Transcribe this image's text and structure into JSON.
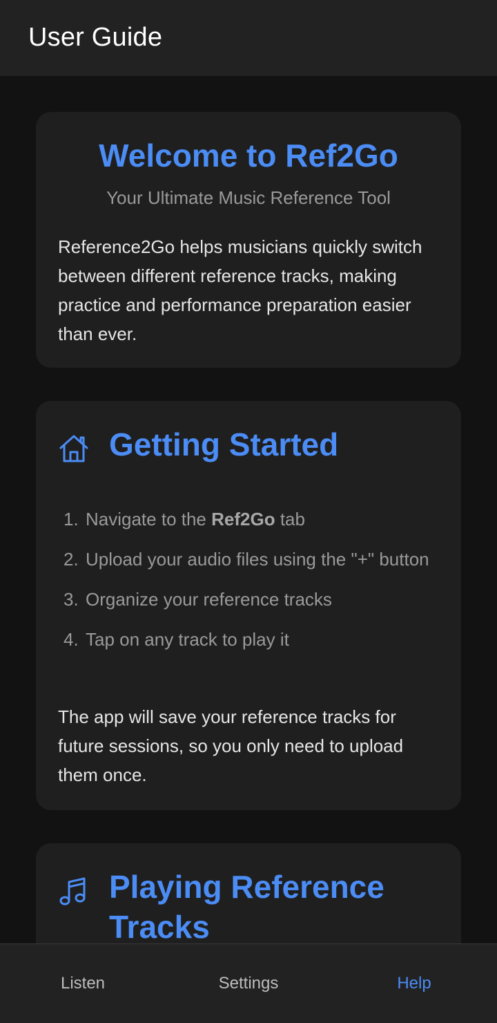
{
  "header": {
    "title": "User Guide"
  },
  "welcome": {
    "title": "Welcome to Ref2Go",
    "subtitle": "Your Ultimate Music Reference Tool",
    "body": "Reference2Go helps musicians quickly switch between different reference tracks, making practice and performance preparation easier than ever."
  },
  "getting_started": {
    "icon": "home-icon",
    "title": "Getting Started",
    "steps": [
      {
        "num": "1.",
        "before": "Navigate to the ",
        "bold": "Ref2Go",
        "after": " tab"
      },
      {
        "num": "2.",
        "text": "Upload your audio files using the \"+\" button"
      },
      {
        "num": "3.",
        "text": "Organize your reference tracks"
      },
      {
        "num": "4.",
        "text": "Tap on any track to play it"
      }
    ],
    "footer": "The app will save your reference tracks for future sessions, so you only need to upload them once."
  },
  "playing": {
    "icon": "music-note-icon",
    "title": "Playing Reference Tracks"
  },
  "tabs": [
    {
      "label": "Listen",
      "active": false
    },
    {
      "label": "Settings",
      "active": false
    },
    {
      "label": "Help",
      "active": true
    }
  ],
  "colors": {
    "accent": "#4b8cf5",
    "background": "#121212",
    "card": "#1f1f1f",
    "bar": "#222222"
  }
}
